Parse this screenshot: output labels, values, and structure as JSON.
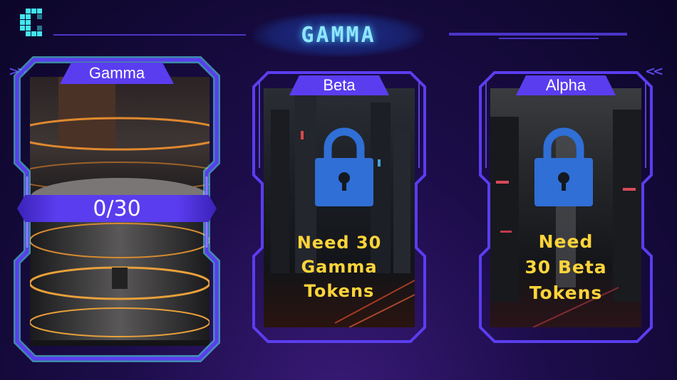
{
  "header": {
    "title": "GAMMA",
    "back_icon": "back-arrow-icon"
  },
  "colors": {
    "accent_purple": "#5b3df0",
    "highlight_cyan": "#5ef3ff",
    "lock_blue": "#2f6fd6",
    "requirement_yellow": "#ffd43a"
  },
  "cards": [
    {
      "name": "Gamma",
      "progress_text": "0/30",
      "selected": true,
      "locked": false
    },
    {
      "name": "Beta",
      "locked": true,
      "lock_icon": "padlock-icon",
      "requirement": [
        "Need 30",
        "Gamma",
        "Tokens"
      ]
    },
    {
      "name": "Alpha",
      "locked": true,
      "lock_icon": "padlock-icon",
      "requirement": [
        "Need",
        "30 Beta",
        "Tokens"
      ]
    }
  ]
}
